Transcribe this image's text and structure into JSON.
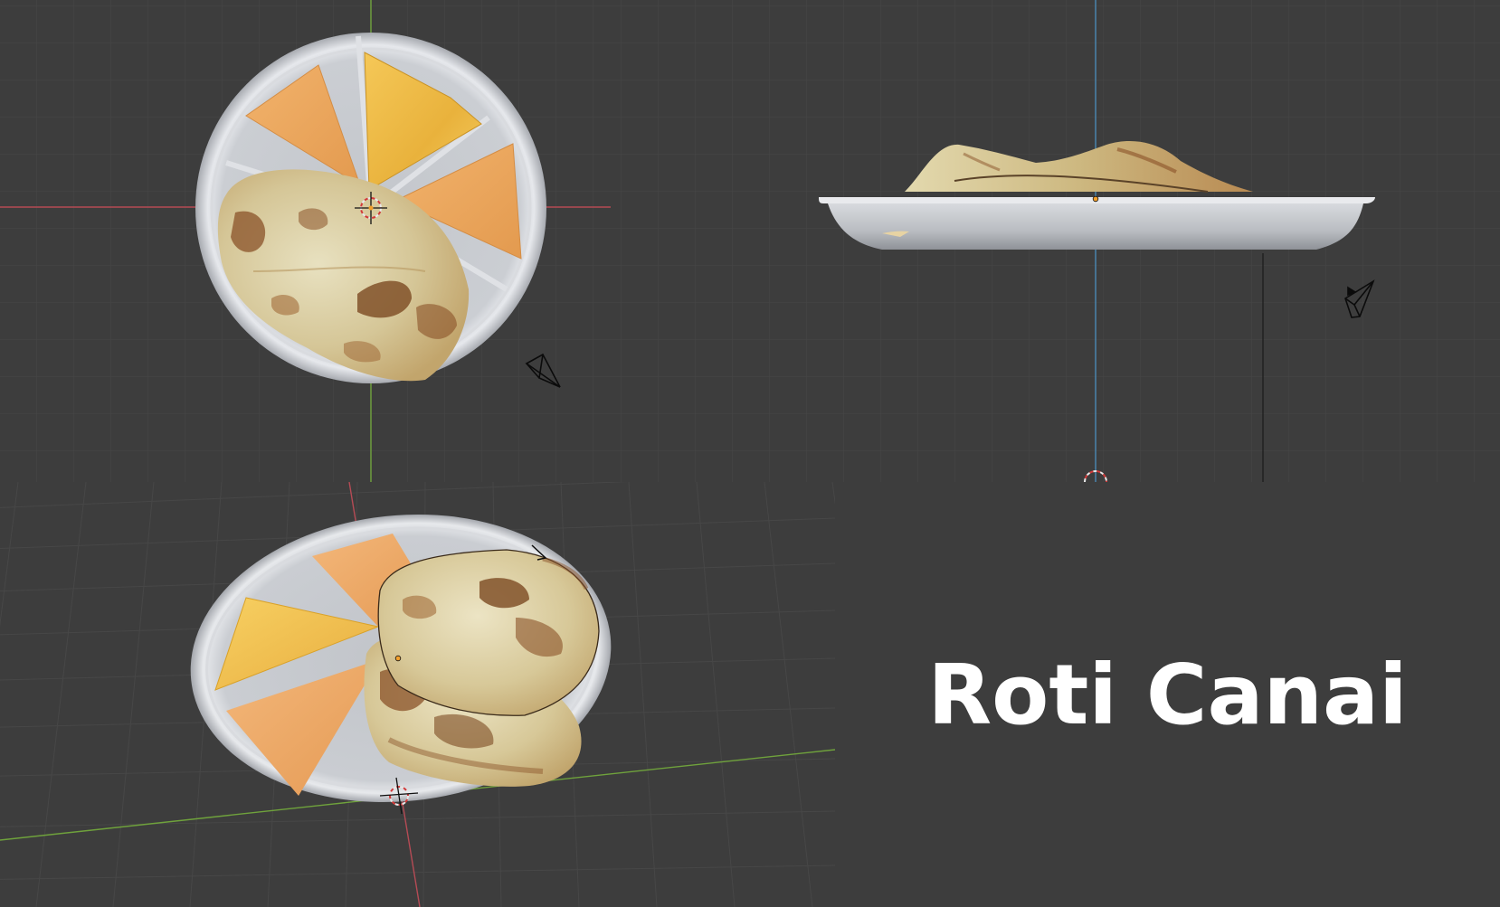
{
  "title": "Roti Canai",
  "viewports": [
    {
      "name": "top-view",
      "objects": [
        "plate",
        "roti",
        "cheese-slice",
        "cheese-slice",
        "cheese-slice",
        "camera",
        "3d-cursor"
      ]
    },
    {
      "name": "side-view",
      "objects": [
        "plate",
        "roti",
        "camera",
        "3d-cursor"
      ]
    },
    {
      "name": "perspective-view",
      "objects": [
        "plate",
        "roti",
        "cheese-slice",
        "cheese-slice",
        "cheese-slice",
        "camera",
        "3d-cursor"
      ]
    }
  ],
  "colors": {
    "background": "#3d3d3d",
    "grid_line": "#474747",
    "x_axis": "#b54b55",
    "y_axis": "#6fa23c",
    "z_axis": "#4b89b5",
    "plate": "#c9ccd1",
    "plate_rim": "#e4e6ea",
    "cheese": "#eaa75f",
    "cheese_bright": "#f2bd4a",
    "roti": "#d9cfa0",
    "roti_brown": "#8a5228",
    "title_text": "#ffffff"
  },
  "icons": [
    "camera-icon",
    "3d-cursor-icon",
    "origin-dot-icon"
  ]
}
